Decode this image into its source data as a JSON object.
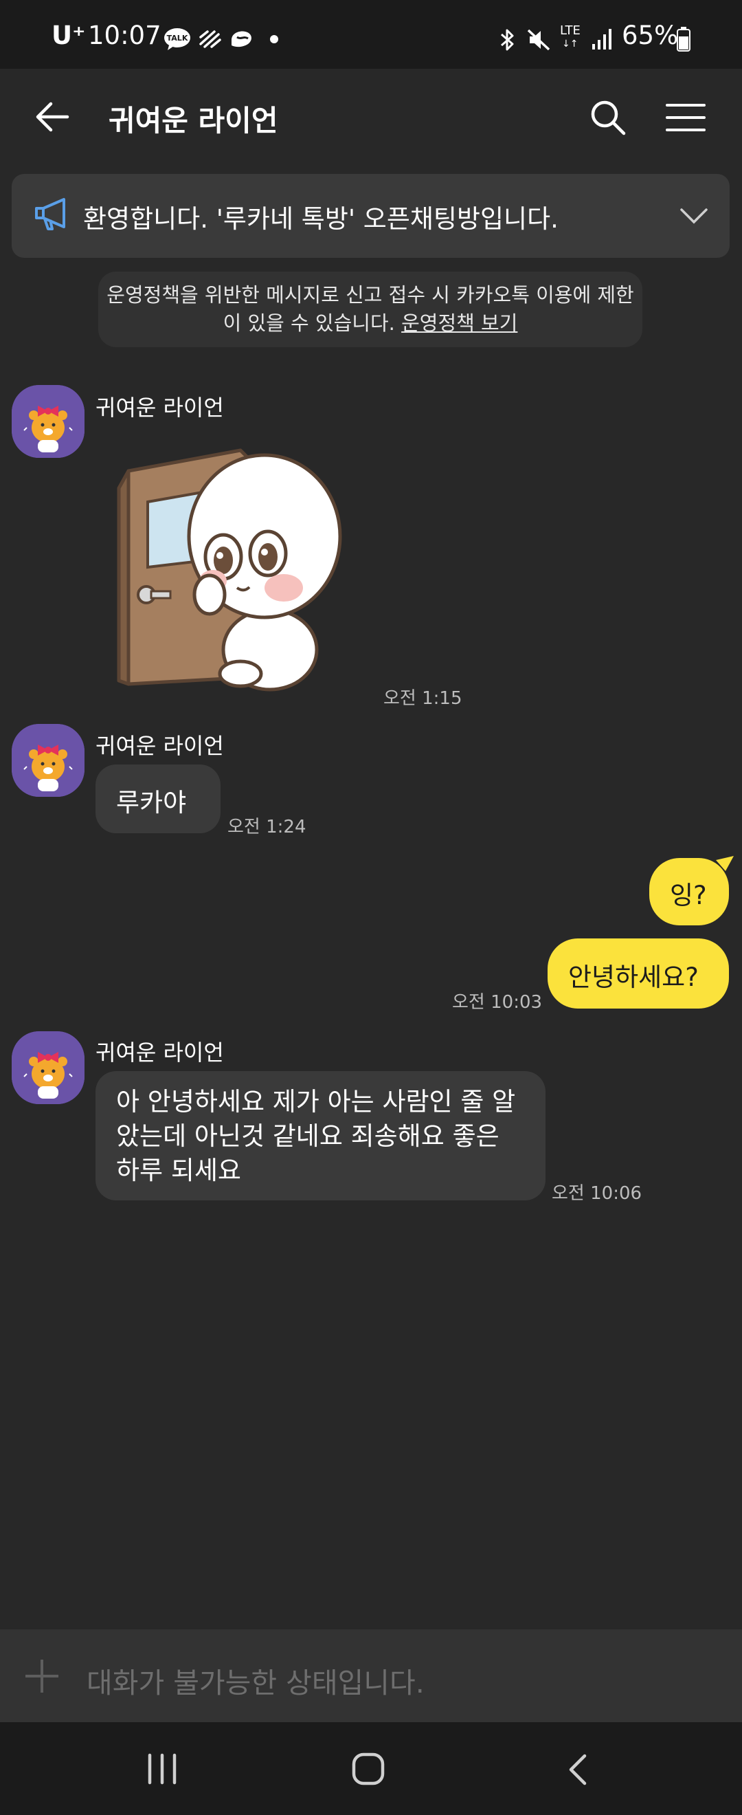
{
  "status_bar": {
    "carrier": "U⁺",
    "time": "10:07",
    "network": "LTE",
    "battery": "65%"
  },
  "header": {
    "title": "귀여운 라이언"
  },
  "notice": {
    "text": "환영합니다. '루카네 톡방' 오픈채팅방입니다."
  },
  "policy": {
    "text": "운영정책을 위반한 메시지로 신고 접수 시 카카오톡 이용에 제한이 있을 수 있습니다.",
    "link": "운영정책 보기"
  },
  "messages": [
    {
      "sender": "귀여운 라이언",
      "type": "sticker",
      "time": "오전 1:15"
    },
    {
      "sender": "귀여운 라이언",
      "type": "text",
      "text": "루카야",
      "time": "오전 1:24"
    },
    {
      "sender": "me",
      "type": "text",
      "text": "잉?"
    },
    {
      "sender": "me",
      "type": "text",
      "text": "안녕하세요?",
      "time": "오전 10:03"
    },
    {
      "sender": "귀여운 라이언",
      "type": "text",
      "text": "아 안녕하세요 제가 아는 사람인 줄 알았는데 아닌것 같네요 죄송해요 좋은 하루 되세요",
      "time": "오전 10:06"
    }
  ],
  "input": {
    "placeholder": "대화가 불가능한 상태입니다."
  },
  "colors": {
    "background": "#282828",
    "my_bubble": "#fbe23c",
    "other_bubble": "#3a3a3a",
    "avatar_bg": "#6a53a8",
    "notice_icon": "#5a9fe8"
  }
}
